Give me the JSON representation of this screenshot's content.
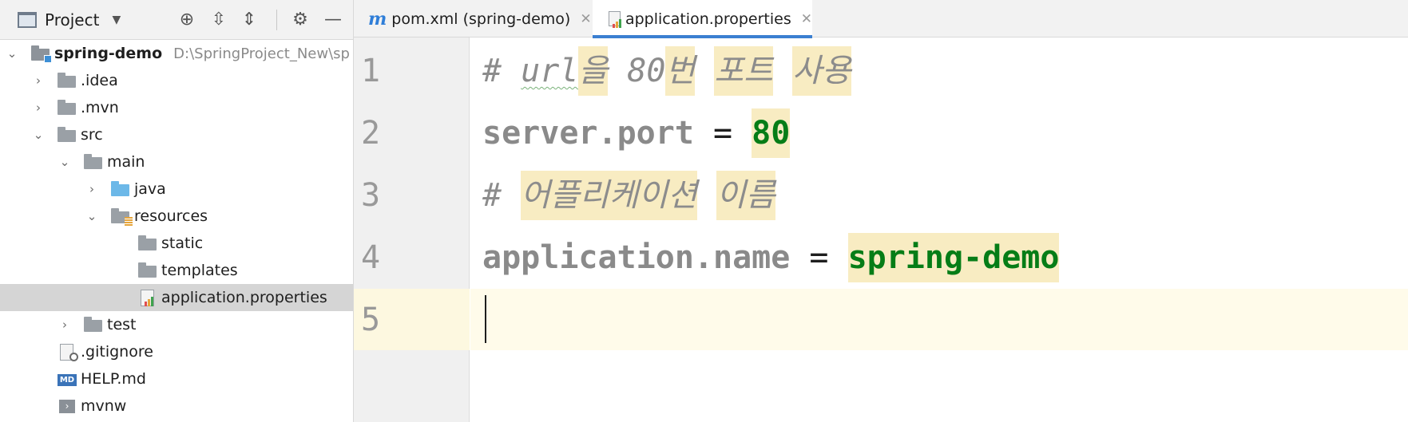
{
  "project_panel": {
    "view_label": "Project",
    "toolbar_icons": [
      "locate-icon",
      "expand-all-icon",
      "collapse-all-icon",
      "gear-icon",
      "minimize-icon"
    ],
    "tree": [
      {
        "label": "spring-demo",
        "path": "D:\\SpringProject_New\\sp",
        "expanded": true
      },
      {
        "label": ".idea",
        "expanded": false
      },
      {
        "label": ".mvn",
        "expanded": false
      },
      {
        "label": "src",
        "expanded": true
      },
      {
        "label": "main",
        "expanded": true
      },
      {
        "label": "java",
        "expanded": false
      },
      {
        "label": "resources",
        "expanded": true
      },
      {
        "label": "static"
      },
      {
        "label": "templates"
      },
      {
        "label": "application.properties",
        "selected": true
      },
      {
        "label": "test",
        "expanded": false
      },
      {
        "label": ".gitignore"
      },
      {
        "label": "HELP.md"
      },
      {
        "label": "mvnw"
      }
    ]
  },
  "editor": {
    "tabs": [
      {
        "label": "pom.xml (spring-demo)",
        "active": false
      },
      {
        "label": "application.properties",
        "active": true
      }
    ],
    "line_numbers": [
      "1",
      "2",
      "3",
      "4",
      "5"
    ],
    "lines": {
      "l1": {
        "hash": "# ",
        "word_url": "url",
        "rest": [
          "을",
          " 80",
          "번",
          " ",
          "포트",
          " ",
          "사용"
        ]
      },
      "l2": {
        "key": "server.port",
        "op": " = ",
        "value": "80"
      },
      "l3": {
        "hash": "# ",
        "w1": "어플리케이션",
        "w2": "이름"
      },
      "l4": {
        "key": "application.name",
        "op": " = ",
        "value": "spring-demo"
      }
    },
    "current_line": 5
  },
  "colors": {
    "accent": "#3b7fd1",
    "string_value": "#067d17",
    "comment": "#8c8c8c",
    "highlight": "#f8ecc2",
    "current_line": "#fffbea"
  }
}
